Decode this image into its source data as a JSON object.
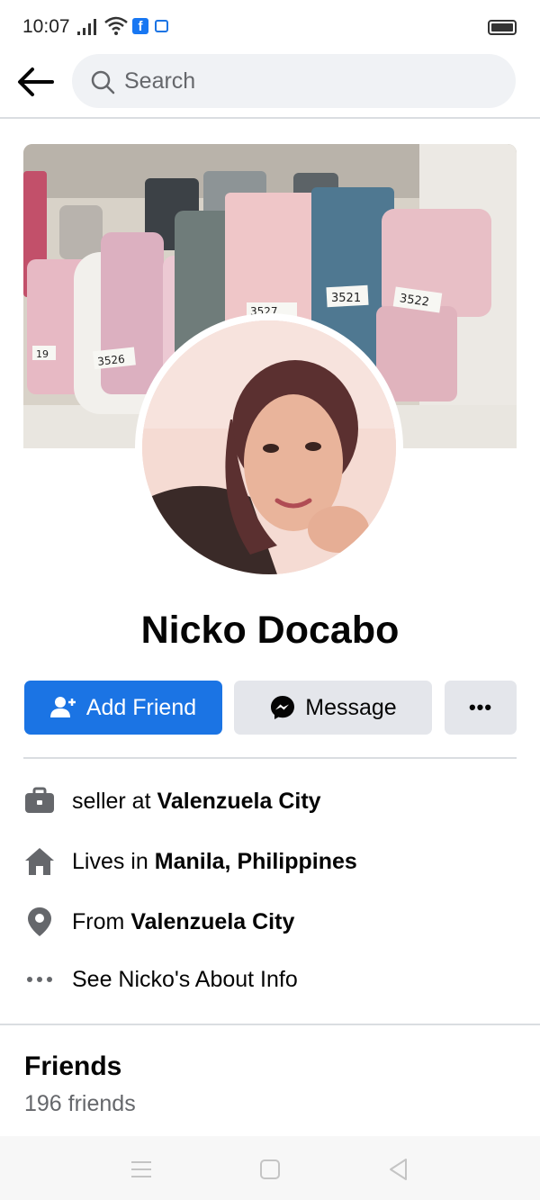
{
  "status_bar": {
    "time": "10:07"
  },
  "header": {
    "back_icon": "arrow-left-icon",
    "search_placeholder": "Search"
  },
  "profile": {
    "name": "Nicko Docabo",
    "cover_labels": [
      "3521",
      "3522",
      "3526",
      "3527",
      "19"
    ]
  },
  "actions": {
    "add_friend": "Add Friend",
    "message": "Message",
    "more": "•••"
  },
  "info": {
    "work_prefix": "seller at",
    "work_place": "Valenzuela City",
    "lives_prefix": "Lives in",
    "lives_place": "Manila, Philippines",
    "from_prefix": "From",
    "from_place": "Valenzuela City",
    "about_link": "See Nicko's About Info"
  },
  "friends": {
    "title": "Friends",
    "count": "196 friends"
  },
  "colors": {
    "primary": "#1b74e4",
    "secondary_button": "#e4e6eb",
    "muted_text": "#65676b",
    "divider": "#dadde1",
    "search_bg": "#f0f2f5"
  }
}
